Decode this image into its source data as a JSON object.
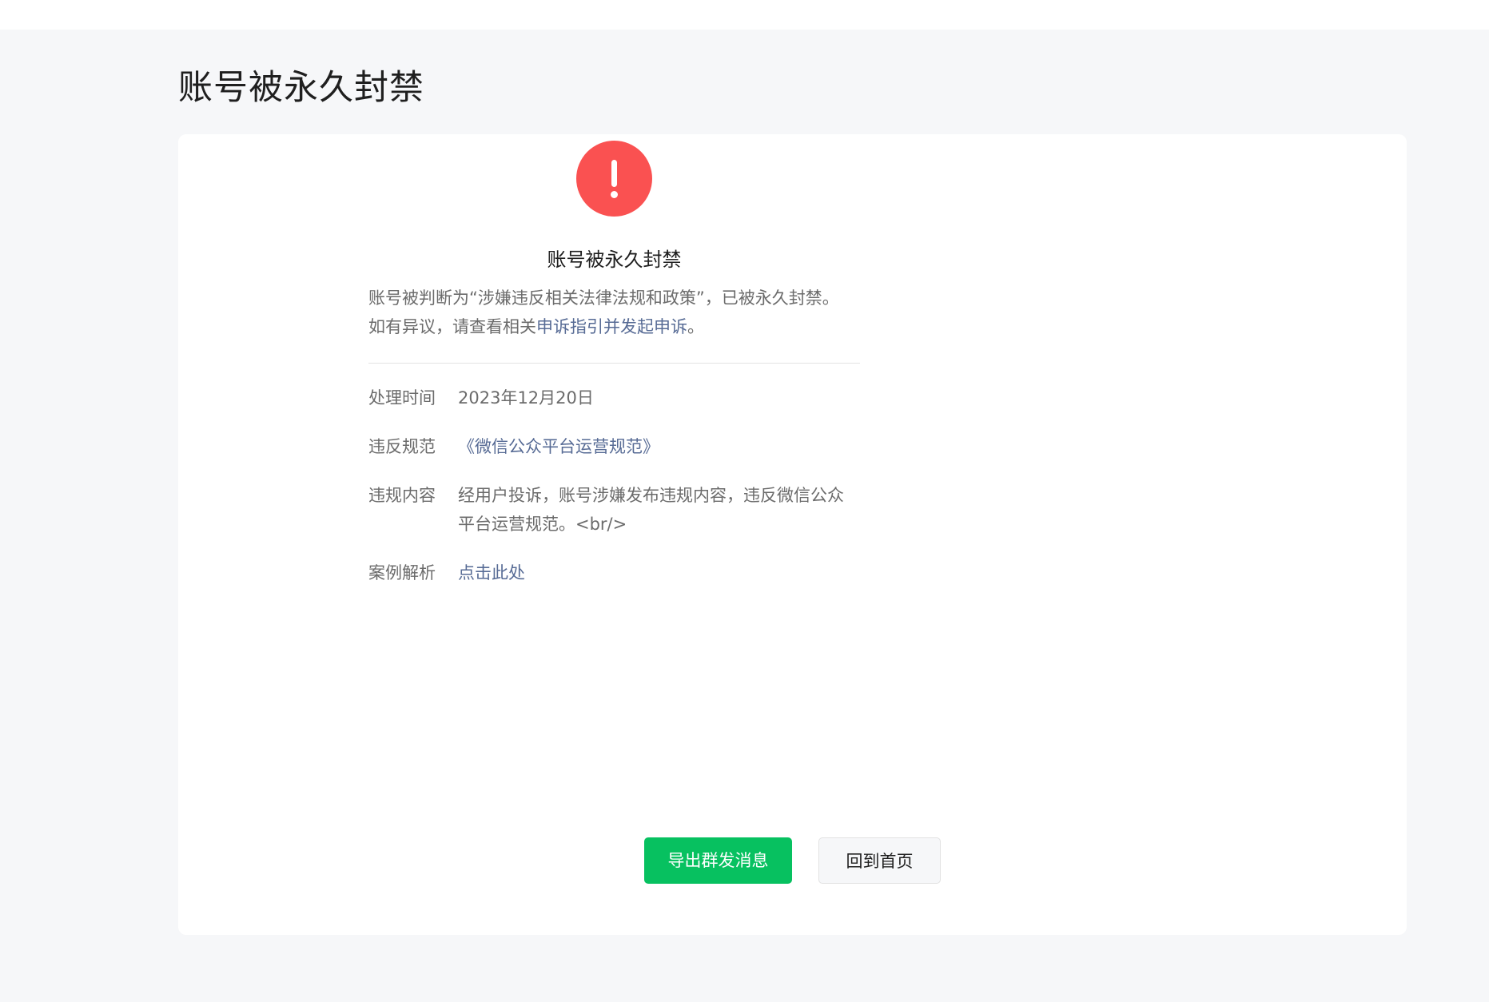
{
  "page": {
    "title": "账号被永久封禁"
  },
  "notice": {
    "icon": "warning-icon",
    "icon_color": "#fa5151",
    "title": "账号被永久封禁",
    "desc_part1": "账号被判断为“涉嫌违反相关法律法规和政策”，已被永久封禁。",
    "desc_part2": "如有异议，请查看相关",
    "desc_link": "申诉指引并发起申诉",
    "desc_part3": "。"
  },
  "details": {
    "time_label": "处理时间",
    "time_value": "2023年12月20日",
    "rule_label": "违反规范",
    "rule_value": "《微信公众平台运营规范》",
    "content_label": "违规内容",
    "content_value": "经用户投诉，账号涉嫌发布违规内容，违反微信公众平台运营规范。<br/>",
    "case_label": "案例解析",
    "case_value": "点击此处"
  },
  "actions": {
    "export_label": "导出群发消息",
    "home_label": "回到首页"
  },
  "colors": {
    "accent": "#07c160",
    "link": "#576b95",
    "danger": "#fa5151",
    "page_bg": "#f6f7f9"
  }
}
